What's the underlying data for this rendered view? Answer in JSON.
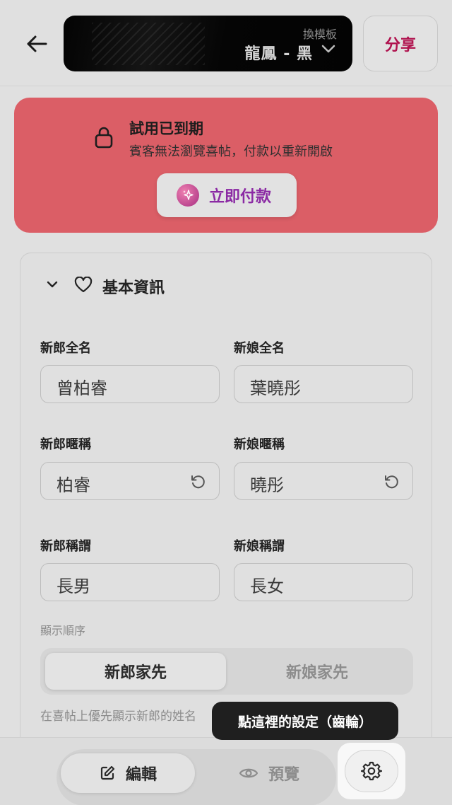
{
  "header": {
    "template_label": "換模板",
    "template_name": "龍鳳 - 黑",
    "share_label": "分享"
  },
  "banner": {
    "title": "試用已到期",
    "subtitle": "賓客無法瀏覽喜帖，付款以重新開啟",
    "pay_label": "立即付款"
  },
  "basic_info": {
    "section_title": "基本資訊",
    "groom_name_label": "新郎全名",
    "groom_name": "曾柏睿",
    "bride_name_label": "新娘全名",
    "bride_name": "葉曉彤",
    "groom_nick_label": "新郎暱稱",
    "groom_nick": "柏睿",
    "bride_nick_label": "新娘暱稱",
    "bride_nick": "曉彤",
    "groom_title_label": "新郎稱謂",
    "groom_title": "長男",
    "bride_title_label": "新娘稱謂",
    "bride_title": "長女",
    "order_label": "顯示順序",
    "order_options": [
      "新郎家先",
      "新娘家先"
    ],
    "order_selected": "新郎家先",
    "helper_text": "在喜帖上優先顯示新郎的姓名"
  },
  "bottom": {
    "edit_label": "編輯",
    "preview_label": "預覽"
  },
  "tooltip": {
    "text": "點這裡的設定（齒輪）"
  },
  "colors": {
    "banner_bg": "#db5e66",
    "share_text": "#b0124e",
    "pay_text": "#8b2aa4",
    "tooltip_bg": "#1f1f1f"
  }
}
